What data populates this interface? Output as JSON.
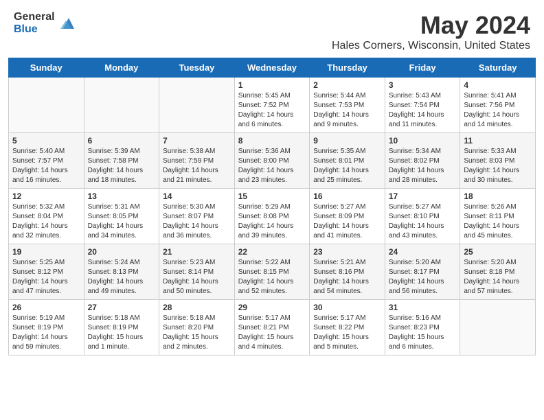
{
  "header": {
    "logo_general": "General",
    "logo_blue": "Blue",
    "month": "May 2024",
    "location": "Hales Corners, Wisconsin, United States"
  },
  "days_of_week": [
    "Sunday",
    "Monday",
    "Tuesday",
    "Wednesday",
    "Thursday",
    "Friday",
    "Saturday"
  ],
  "weeks": [
    [
      {
        "day": "",
        "sunrise": "",
        "sunset": "",
        "daylight": ""
      },
      {
        "day": "",
        "sunrise": "",
        "sunset": "",
        "daylight": ""
      },
      {
        "day": "",
        "sunrise": "",
        "sunset": "",
        "daylight": ""
      },
      {
        "day": "1",
        "sunrise": "Sunrise: 5:45 AM",
        "sunset": "Sunset: 7:52 PM",
        "daylight": "Daylight: 14 hours and 6 minutes."
      },
      {
        "day": "2",
        "sunrise": "Sunrise: 5:44 AM",
        "sunset": "Sunset: 7:53 PM",
        "daylight": "Daylight: 14 hours and 9 minutes."
      },
      {
        "day": "3",
        "sunrise": "Sunrise: 5:43 AM",
        "sunset": "Sunset: 7:54 PM",
        "daylight": "Daylight: 14 hours and 11 minutes."
      },
      {
        "day": "4",
        "sunrise": "Sunrise: 5:41 AM",
        "sunset": "Sunset: 7:56 PM",
        "daylight": "Daylight: 14 hours and 14 minutes."
      }
    ],
    [
      {
        "day": "5",
        "sunrise": "Sunrise: 5:40 AM",
        "sunset": "Sunset: 7:57 PM",
        "daylight": "Daylight: 14 hours and 16 minutes."
      },
      {
        "day": "6",
        "sunrise": "Sunrise: 5:39 AM",
        "sunset": "Sunset: 7:58 PM",
        "daylight": "Daylight: 14 hours and 18 minutes."
      },
      {
        "day": "7",
        "sunrise": "Sunrise: 5:38 AM",
        "sunset": "Sunset: 7:59 PM",
        "daylight": "Daylight: 14 hours and 21 minutes."
      },
      {
        "day": "8",
        "sunrise": "Sunrise: 5:36 AM",
        "sunset": "Sunset: 8:00 PM",
        "daylight": "Daylight: 14 hours and 23 minutes."
      },
      {
        "day": "9",
        "sunrise": "Sunrise: 5:35 AM",
        "sunset": "Sunset: 8:01 PM",
        "daylight": "Daylight: 14 hours and 25 minutes."
      },
      {
        "day": "10",
        "sunrise": "Sunrise: 5:34 AM",
        "sunset": "Sunset: 8:02 PM",
        "daylight": "Daylight: 14 hours and 28 minutes."
      },
      {
        "day": "11",
        "sunrise": "Sunrise: 5:33 AM",
        "sunset": "Sunset: 8:03 PM",
        "daylight": "Daylight: 14 hours and 30 minutes."
      }
    ],
    [
      {
        "day": "12",
        "sunrise": "Sunrise: 5:32 AM",
        "sunset": "Sunset: 8:04 PM",
        "daylight": "Daylight: 14 hours and 32 minutes."
      },
      {
        "day": "13",
        "sunrise": "Sunrise: 5:31 AM",
        "sunset": "Sunset: 8:05 PM",
        "daylight": "Daylight: 14 hours and 34 minutes."
      },
      {
        "day": "14",
        "sunrise": "Sunrise: 5:30 AM",
        "sunset": "Sunset: 8:07 PM",
        "daylight": "Daylight: 14 hours and 36 minutes."
      },
      {
        "day": "15",
        "sunrise": "Sunrise: 5:29 AM",
        "sunset": "Sunset: 8:08 PM",
        "daylight": "Daylight: 14 hours and 39 minutes."
      },
      {
        "day": "16",
        "sunrise": "Sunrise: 5:27 AM",
        "sunset": "Sunset: 8:09 PM",
        "daylight": "Daylight: 14 hours and 41 minutes."
      },
      {
        "day": "17",
        "sunrise": "Sunrise: 5:27 AM",
        "sunset": "Sunset: 8:10 PM",
        "daylight": "Daylight: 14 hours and 43 minutes."
      },
      {
        "day": "18",
        "sunrise": "Sunrise: 5:26 AM",
        "sunset": "Sunset: 8:11 PM",
        "daylight": "Daylight: 14 hours and 45 minutes."
      }
    ],
    [
      {
        "day": "19",
        "sunrise": "Sunrise: 5:25 AM",
        "sunset": "Sunset: 8:12 PM",
        "daylight": "Daylight: 14 hours and 47 minutes."
      },
      {
        "day": "20",
        "sunrise": "Sunrise: 5:24 AM",
        "sunset": "Sunset: 8:13 PM",
        "daylight": "Daylight: 14 hours and 49 minutes."
      },
      {
        "day": "21",
        "sunrise": "Sunrise: 5:23 AM",
        "sunset": "Sunset: 8:14 PM",
        "daylight": "Daylight: 14 hours and 50 minutes."
      },
      {
        "day": "22",
        "sunrise": "Sunrise: 5:22 AM",
        "sunset": "Sunset: 8:15 PM",
        "daylight": "Daylight: 14 hours and 52 minutes."
      },
      {
        "day": "23",
        "sunrise": "Sunrise: 5:21 AM",
        "sunset": "Sunset: 8:16 PM",
        "daylight": "Daylight: 14 hours and 54 minutes."
      },
      {
        "day": "24",
        "sunrise": "Sunrise: 5:20 AM",
        "sunset": "Sunset: 8:17 PM",
        "daylight": "Daylight: 14 hours and 56 minutes."
      },
      {
        "day": "25",
        "sunrise": "Sunrise: 5:20 AM",
        "sunset": "Sunset: 8:18 PM",
        "daylight": "Daylight: 14 hours and 57 minutes."
      }
    ],
    [
      {
        "day": "26",
        "sunrise": "Sunrise: 5:19 AM",
        "sunset": "Sunset: 8:19 PM",
        "daylight": "Daylight: 14 hours and 59 minutes."
      },
      {
        "day": "27",
        "sunrise": "Sunrise: 5:18 AM",
        "sunset": "Sunset: 8:19 PM",
        "daylight": "Daylight: 15 hours and 1 minute."
      },
      {
        "day": "28",
        "sunrise": "Sunrise: 5:18 AM",
        "sunset": "Sunset: 8:20 PM",
        "daylight": "Daylight: 15 hours and 2 minutes."
      },
      {
        "day": "29",
        "sunrise": "Sunrise: 5:17 AM",
        "sunset": "Sunset: 8:21 PM",
        "daylight": "Daylight: 15 hours and 4 minutes."
      },
      {
        "day": "30",
        "sunrise": "Sunrise: 5:17 AM",
        "sunset": "Sunset: 8:22 PM",
        "daylight": "Daylight: 15 hours and 5 minutes."
      },
      {
        "day": "31",
        "sunrise": "Sunrise: 5:16 AM",
        "sunset": "Sunset: 8:23 PM",
        "daylight": "Daylight: 15 hours and 6 minutes."
      },
      {
        "day": "",
        "sunrise": "",
        "sunset": "",
        "daylight": ""
      }
    ]
  ]
}
